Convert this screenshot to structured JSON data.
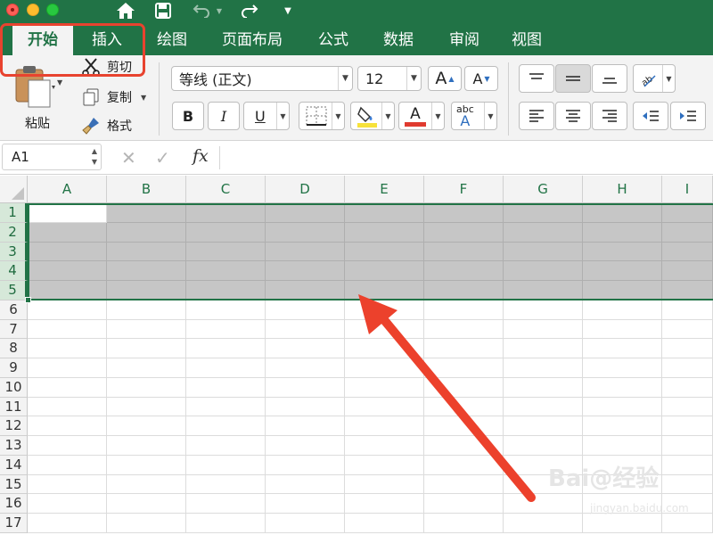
{
  "ribbon_tabs": [
    "开始",
    "插入",
    "绘图",
    "页面布局",
    "公式",
    "数据",
    "审阅",
    "视图"
  ],
  "clipboard": {
    "paste": "粘贴",
    "cut": "剪切",
    "copy": "复制",
    "format": "格式"
  },
  "font": {
    "name": "等线 (正文)",
    "size": "12",
    "increase": "A",
    "decrease": "A"
  },
  "format_buttons": {
    "bold": "B",
    "italic": "I",
    "underline": "U",
    "font_color": "A",
    "phonetic": "abc",
    "phonetic_a": "A"
  },
  "name_box": "A1",
  "formula_label": "fx",
  "formula_cancel": "✕",
  "formula_enter": "✓",
  "columns": [
    "A",
    "B",
    "C",
    "D",
    "E",
    "F",
    "G",
    "H",
    "I"
  ],
  "rows": [
    "1",
    "2",
    "3",
    "4",
    "5",
    "6",
    "7",
    "8",
    "9",
    "10",
    "11",
    "12",
    "13",
    "14",
    "15",
    "16",
    "17"
  ],
  "selection": {
    "range": "A1:I5",
    "selected_rows": [
      "1",
      "2",
      "3",
      "4",
      "5"
    ],
    "active_cell": "A1"
  },
  "watermark": "Bai@经验",
  "watermark_sub": "jingyan.baidu.com",
  "colors": {
    "excel_green": "#217346",
    "annotation_red": "#e8432f",
    "selection_gray": "#c6c6c6"
  }
}
